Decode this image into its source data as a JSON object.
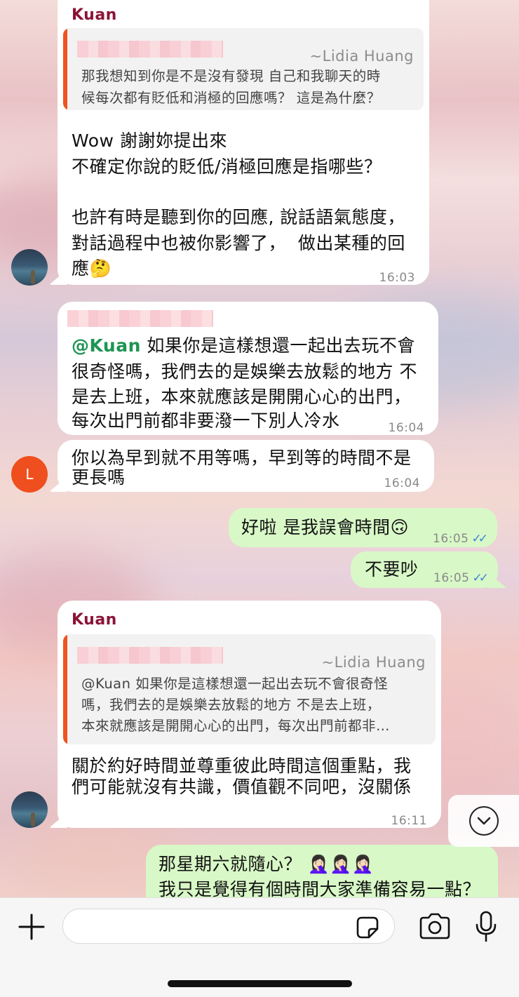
{
  "messages": {
    "m1": {
      "sender": "Kuan",
      "quote_author": "~Lidia Huang",
      "quote_line1": "那我想知到你是不是沒有發現 自己和我聊天的時",
      "quote_line2": "候每次都有貶低和消極的回應嗎？  這是為什麼？",
      "line1": "Wow 謝謝妳提出來",
      "line2": "不確定你說的貶低/消極回應是指哪些？",
      "line3": "也許有時是聽到你的回應, 說話語氣態度，",
      "line4": "對話過程中也被你影響了，  做出某種的回",
      "line5": "應🤔",
      "time": "16:03"
    },
    "m2": {
      "mention": "@Kuan",
      "line1": " 如果你是這樣想還一起出去玩不會",
      "line2": "很奇怪嗎，我們去的是娛樂去放鬆的地方 不",
      "line3": "是去上班，本來就應該是開開心心的出門，",
      "line4": "每次出門前都非要潑一下別人冷水",
      "time": "16:04"
    },
    "m3": {
      "avatar_letter": "L",
      "line1": "你以為早到就不用等嗎，早到等的時間不是",
      "line2": "更長嗎",
      "time": "16:04"
    },
    "m4": {
      "text": "好啦 是我誤會時間🙃",
      "time": "16:05",
      "checks": "✓✓"
    },
    "m5": {
      "text": "不要吵",
      "time": "16:05",
      "checks": "✓✓"
    },
    "m6": {
      "sender": "Kuan",
      "quote_author": "~Lidia Huang",
      "quote_line1": "@Kuan 如果你是這樣想還一起出去玩不會很奇怪",
      "quote_line2": "嗎，我們去的是娛樂去放鬆的地方 不是去上班，",
      "quote_line3": "本來就應該是開開心心的出門，每次出門前都非…",
      "line1": "關於約好時間並尊重彼此時間這個重點，我",
      "line2": "們可能就沒有共識，價值觀不同吧，沒關係",
      "time": "16:11"
    },
    "m7": {
      "line1": "那星期六就隨心？ 🤦🏻‍♀️🤦🏻‍♀️🤦🏻‍♀️",
      "line2": "我只是覺得有個時間大家準備容易一點？"
    }
  },
  "composer": {
    "placeholder": ""
  },
  "icons": [
    "plus-icon",
    "sticker-icon",
    "camera-icon",
    "microphone-icon",
    "chevron-down-icon"
  ],
  "colors": {
    "sender": "#8a1438",
    "mention": "#1d9552",
    "outgoing_bubble": "#d8f8c7",
    "quote_bar": "#f0531f",
    "avatar_l": "#ef4f1e",
    "read_checks": "#3a86d6"
  }
}
